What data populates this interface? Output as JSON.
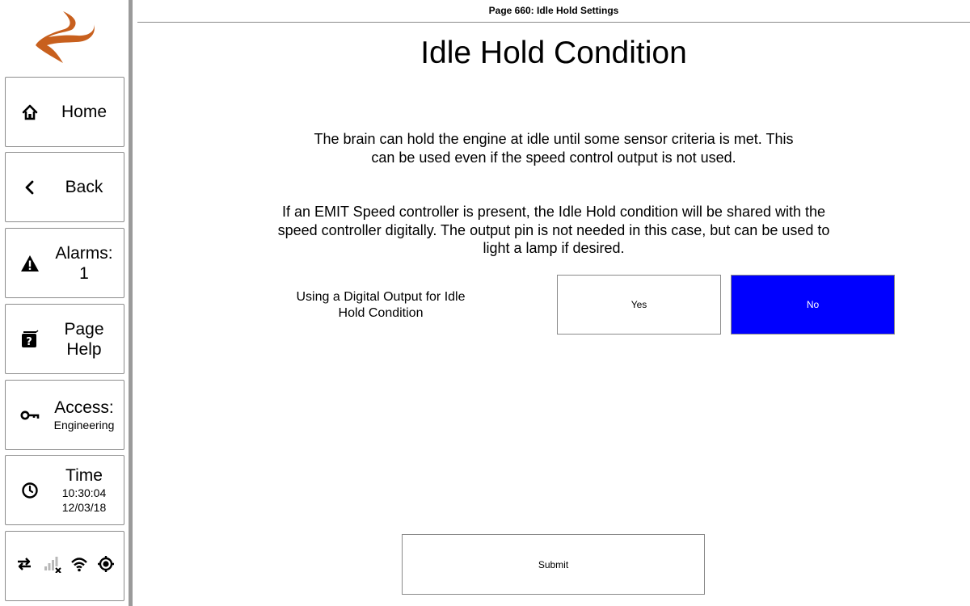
{
  "page": {
    "header": "Page 660: Idle Hold Settings",
    "title": "Idle Hold Condition",
    "description_1": "The brain can hold the engine at idle until some sensor criteria is met. This can be used even if the speed control output is not used.",
    "description_2": "If an EMIT Speed controller is present, the Idle Hold condition will be shared with the speed controller digitally. The output pin is not needed in this case, but can be used to light a lamp if desired."
  },
  "setting": {
    "label": "Using a Digital Output for Idle Hold Condition",
    "options": [
      {
        "label": "Yes",
        "selected": false
      },
      {
        "label": "No",
        "selected": true
      }
    ],
    "selected_color": "#0000ff"
  },
  "submit_label": "Submit",
  "sidebar": {
    "logo_color": "#c8601e",
    "home": {
      "label": "Home",
      "icon": "home-icon"
    },
    "back": {
      "label": "Back",
      "icon": "chevron-left-icon"
    },
    "alarms": {
      "label": "Alarms:",
      "count": "1",
      "icon": "warning-icon"
    },
    "page_help": {
      "label_line1": "Page",
      "label_line2": "Help",
      "icon": "help-icon"
    },
    "access": {
      "label": "Access:",
      "level": "Engineering",
      "icon": "key-icon"
    },
    "time": {
      "label": "Time",
      "clock": "10:30:04",
      "date": "12/03/18",
      "icon": "clock-icon"
    },
    "status": [
      "sync-arrows-icon",
      "signal-off-icon",
      "wifi-icon",
      "gps-icon"
    ]
  }
}
